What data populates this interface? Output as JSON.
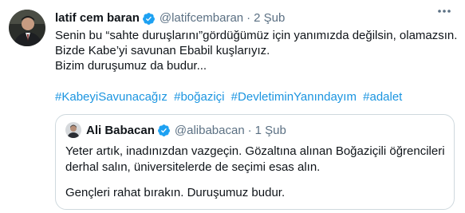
{
  "tweet": {
    "author_name": "latif cem baran",
    "author_handle": "@latifcembaran",
    "separator": "·",
    "date": "2 Şub",
    "more_icon": "more-dots-icon",
    "lines": [
      "Senin bu “sahte duruşlarını”gördüğümüz için yanımızda değilsin, olamazsın.",
      "Bizde Kabe’yi savunan Ebabil kuşlarıyız.",
      "Bizim duruşumuz da budur..."
    ],
    "hashtags": [
      "#KabeyiSavunacağız",
      "#boğaziçi",
      "#DevletiminYanındayım",
      "#adalet"
    ],
    "verified_icon": "verified-badge-icon"
  },
  "quoted": {
    "author_name": "Ali Babacan",
    "author_handle": "@alibabacan",
    "separator": "·",
    "date": "1 Şub",
    "lines": [
      "Yeter artık, inadınızdan vazgeçin. Gözaltına alınan Boğaziçili öğrencileri",
      "derhal salın, üniversitelerde de seçimi esas alın."
    ],
    "last_line": "Gençleri rahat bırakın. Duruşumuz budur."
  },
  "colors": {
    "text": "#0f1419",
    "secondary": "#5b7083",
    "link": "#1b95e0",
    "verified": "#1da1f2",
    "border": "#cfd9de"
  }
}
